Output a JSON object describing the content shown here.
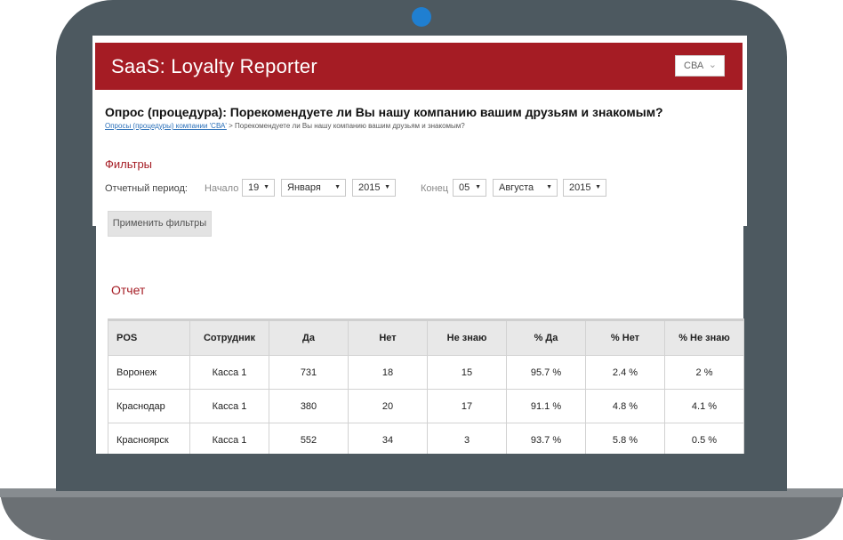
{
  "app": {
    "title": "SaaS: Loyalty Reporter",
    "company": "СВА"
  },
  "page": {
    "title": "Опрос (процедура): Порекомендуете ли Вы нашу компанию вашим друзьям и знакомым?",
    "breadcrumb_link": "Опросы (процедуры) компании 'СВА'",
    "breadcrumb_rest": " > Порекомендуете ли Вы нашу компанию вашим друзьям и знакомым?"
  },
  "filters": {
    "title": "Фильтры",
    "period_label": "Отчетный период:",
    "start_label": "Начало",
    "start_day": "19",
    "start_month": "Января",
    "start_year": "2015",
    "end_label": "Конец",
    "end_day": "05",
    "end_month": "Августа",
    "end_year": "2015",
    "apply_label": "Применить фильтры"
  },
  "report": {
    "title": "Отчет",
    "columns": [
      "POS",
      "Сотрудник",
      "Да",
      "Нет",
      "Не знаю",
      "% Да",
      "% Нет",
      "% Не знаю"
    ],
    "rows": [
      [
        "Воронеж",
        "Касса 1",
        "731",
        "18",
        "15",
        "95.7 %",
        "2.4 %",
        "2 %"
      ],
      [
        "Краснодар",
        "Касса 1",
        "380",
        "20",
        "17",
        "91.1 %",
        "4.8 %",
        "4.1 %"
      ],
      [
        "Красноярск",
        "Касса 1",
        "552",
        "34",
        "3",
        "93.7 %",
        "5.8 %",
        "0.5 %"
      ]
    ]
  },
  "colors": {
    "brand": "#a51c24",
    "laptop_frame": "#4d5960",
    "camera": "#1f7fd1"
  },
  "icons": {
    "select_arrow": "caret-down-icon",
    "company_chevron": "chevron-down-icon"
  }
}
